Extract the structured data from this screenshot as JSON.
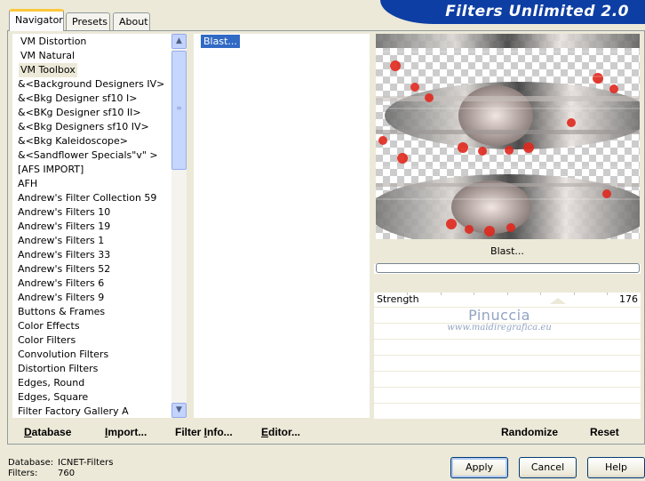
{
  "app": {
    "title": "Filters Unlimited 2.0"
  },
  "tabs": [
    {
      "label": "Navigator",
      "active": true
    },
    {
      "label": "Presets",
      "active": false
    },
    {
      "label": "About",
      "active": false
    }
  ],
  "categories": {
    "selected": "VM Toolbox",
    "items": [
      "VM Distortion",
      "VM Natural",
      "VM Toolbox",
      "&<Background Designers IV>",
      "&<Bkg Designer sf10 I>",
      "&<BKg Designer sf10 II>",
      "&<Bkg Designers sf10 IV>",
      "&<Bkg Kaleidoscope>",
      "&<Sandflower Specials\"v\" >",
      "[AFS IMPORT]",
      "AFH",
      "Andrew's Filter Collection 59",
      "Andrew's Filters 10",
      "Andrew's Filters 19",
      "Andrew's Filters 1",
      "Andrew's Filters 33",
      "Andrew's Filters 52",
      "Andrew's Filters 6",
      "Andrew's Filters 9",
      "Buttons & Frames",
      "Color Effects",
      "Color Filters",
      "Convolution Filters",
      "Distortion Filters",
      "Edges, Round",
      "Edges, Square",
      "Filter Factory Gallery A"
    ]
  },
  "filters": {
    "items": [
      "Blast..."
    ],
    "selected": "Blast..."
  },
  "preview": {
    "filter_name": "Blast..."
  },
  "sliders": [
    {
      "label": "Strength",
      "value": "176"
    }
  ],
  "watermark": {
    "line1": "Pinuccia",
    "line2": "www.maidiregrafica.eu"
  },
  "bottom_buttons": {
    "database": {
      "underline": "D",
      "rest": "atabase"
    },
    "import": {
      "underline": "I",
      "rest": "mport..."
    },
    "filter_info": {
      "pre": "Filter ",
      "underline": "I",
      "rest": "nfo..."
    },
    "editor": {
      "underline": "E",
      "rest": "ditor..."
    },
    "randomize": "Randomize",
    "reset": "Reset"
  },
  "status": {
    "database_label": "Database:",
    "database_value": "ICNET-Filters",
    "filters_label": "Filters:",
    "filters_value": "760"
  },
  "dialog_buttons": {
    "apply": "Apply",
    "cancel": "Cancel",
    "help": "Help"
  },
  "colors": {
    "banner": "#0d3ea3",
    "selection": "#316ac5",
    "accent_tab": "#ffc83c"
  }
}
